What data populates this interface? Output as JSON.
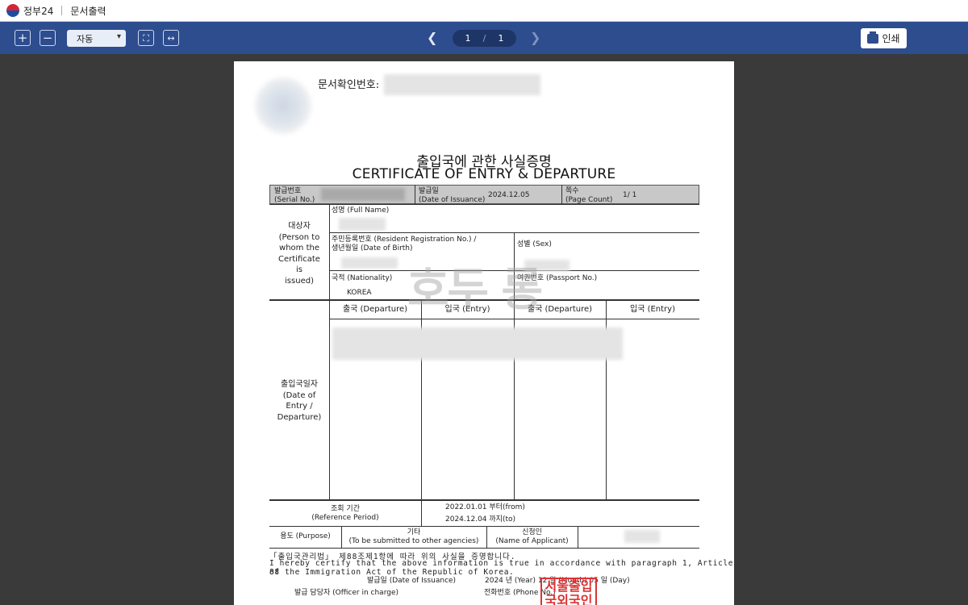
{
  "app": {
    "name": "정부24",
    "section": "문서출력"
  },
  "toolbar": {
    "zoom_in": "+",
    "zoom_out": "−",
    "zoom_value": "자동",
    "page_current": "1",
    "page_total": "1",
    "print_label": "인쇄"
  },
  "doc": {
    "doc_number_label": "문서확인번호:",
    "title_ko": "출입국에 관한 사실증명",
    "title_en": "CERTIFICATE OF ENTRY & DEPARTURE",
    "serial_label": "발급번호",
    "serial_label_en": "(Serial No.)",
    "issue_label": "발급일",
    "issue_label_en": "(Date of Issuance)",
    "issue_date": "2024.12.05",
    "pages_label": "쪽수",
    "pages_label_en": "(Page Count)",
    "pages_value": "1/ 1",
    "subject_ko": "대상자",
    "subject_en1": "(Person to",
    "subject_en2": "whom the",
    "subject_en3": "Certificate",
    "subject_en4": "is",
    "subject_en5": "issued)",
    "name_label": "성명 (Full Name)",
    "rrn_label": "주민등록번호 (Resident Registration No.) /",
    "dob_label": "생년월일 (Date of Birth)",
    "sex_label": "성별 (Sex)",
    "nationality_label": "국적 (Nationality)",
    "nationality_value": "KOREA",
    "passport_label": "여권번호 (Passport No.)",
    "dep1": "출국 (Departure)",
    "ent1": "입국 (Entry)",
    "dep2": "출국 (Departure)",
    "ent2": "입국 (Entry)",
    "date_label_ko": "출입국일자",
    "date_label_en1": "(Date of",
    "date_label_en2": "Entry /",
    "date_label_en3": "Departure)",
    "watermark": "호두 롱",
    "ref_label_ko": "조회 기간",
    "ref_label_en": "(Reference Period)",
    "ref_from": "2022.01.01  부터(from)",
    "ref_to": "2024.12.04  까지(to)",
    "purpose_label": "용도 (Purpose)",
    "other_label": "기타",
    "other_label_en": "(To be submitted to other agencies)",
    "applicant_label": "신청인",
    "applicant_label_en": "(Name of Applicant)",
    "law_line1": "「출입국관리법」 제88조제1항에 따라 위의 사실을 증명합니다.",
    "law_line2": "  I hereby certify that the above information is true in accordance with paragraph 1, Article 88",
    "law_line3": "of the Immigration Act of the Republic of Korea.",
    "issue_footer": "발급일 (Date of Issuance)",
    "issue_footer_value": "2024  년 (Year)   12 월 (Month)   05 일 (Day)",
    "officer_label": "발급 담당자 (Officer in charge)",
    "phone_label": "전화번호 (Phone No.)",
    "red_stamp": "서울출입\n국외국인"
  }
}
